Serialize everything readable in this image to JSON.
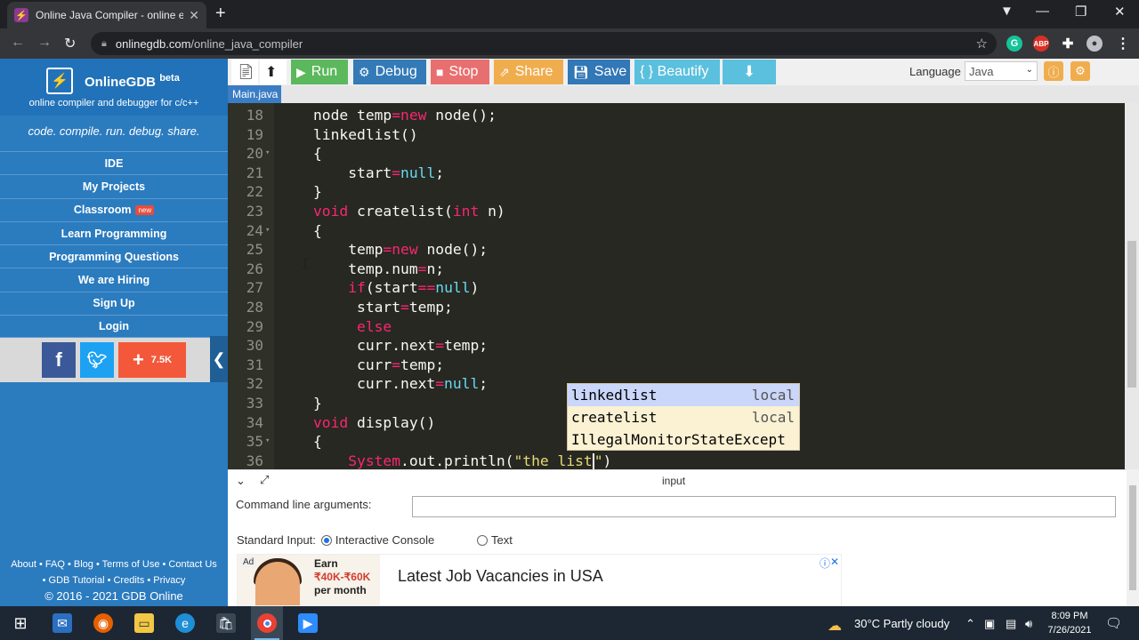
{
  "browser": {
    "tab_title": "Online Java Compiler - online ed",
    "tab_close": "✕",
    "new_tab": "+",
    "url_host": "onlinegdb.com",
    "url_path": "/online_java_compiler"
  },
  "sidebar": {
    "brand": "OnlineGDB",
    "beta": "beta",
    "tagline": "online compiler and debugger for c/c++",
    "motto": "code. compile. run. debug. share.",
    "items": [
      {
        "label": "IDE"
      },
      {
        "label": "My Projects"
      },
      {
        "label": "Classroom",
        "badge": "new"
      },
      {
        "label": "Learn Programming"
      },
      {
        "label": "Programming Questions"
      },
      {
        "label": "We are Hiring"
      },
      {
        "label": "Sign Up"
      },
      {
        "label": "Login"
      }
    ],
    "share_count": "7.5K",
    "footer_line1": "About • FAQ • Blog • Terms of Use • Contact Us",
    "footer_line2": "• GDB Tutorial • Credits • Privacy",
    "copyright": "© 2016 - 2021 GDB Online"
  },
  "toolbar": {
    "run": "Run",
    "debug": "Debug",
    "stop": "Stop",
    "share": "Share",
    "save": "Save",
    "beautify": "{ } Beautify",
    "language_label": "Language",
    "language_value": "Java",
    "colors": {
      "run": "#5cb85c",
      "debug": "#337ab7",
      "stop": "#e86f6f",
      "share": "#f0ad4e",
      "save": "#3277b6",
      "beautify": "#5bc0de",
      "download": "#5bc0de"
    }
  },
  "file_tab": "Main.java",
  "editor": {
    "lines": [
      {
        "n": "18",
        "fold": "",
        "html": "node temp<span class=\"sy\">=</span><span class=\"kw\">new</span> node();"
      },
      {
        "n": "19",
        "fold": "",
        "html": "linkedlist()"
      },
      {
        "n": "20",
        "fold": "▾",
        "html": "{"
      },
      {
        "n": "21",
        "fold": "",
        "html": "    start<span class=\"sy\">=</span><span class=\"nl\">null</span>;"
      },
      {
        "n": "22",
        "fold": "",
        "html": "}"
      },
      {
        "n": "23",
        "fold": "",
        "html": "<span class=\"kw\">void</span> createlist(<span class=\"kw\">int</span> n)"
      },
      {
        "n": "24",
        "fold": "▾",
        "html": "{"
      },
      {
        "n": "25",
        "fold": "",
        "html": "    temp<span class=\"sy\">=</span><span class=\"kw\">new</span> node();"
      },
      {
        "n": "26",
        "fold": "",
        "html": "    temp.num<span class=\"sy\">=</span>n;"
      },
      {
        "n": "27",
        "fold": "",
        "html": "    <span class=\"kw\">if</span>(start<span class=\"sy\">==</span><span class=\"nl\">null</span>)"
      },
      {
        "n": "28",
        "fold": "",
        "html": "     start<span class=\"sy\">=</span>temp;"
      },
      {
        "n": "29",
        "fold": "",
        "html": "     <span class=\"kw\">else</span>"
      },
      {
        "n": "30",
        "fold": "",
        "html": "     curr.next<span class=\"sy\">=</span>temp;"
      },
      {
        "n": "31",
        "fold": "",
        "html": "     curr<span class=\"sy\">=</span>temp;"
      },
      {
        "n": "32",
        "fold": "",
        "html": "     curr.next<span class=\"sy\">=</span><span class=\"nl\">null</span>;"
      },
      {
        "n": "33",
        "fold": "",
        "html": "}"
      },
      {
        "n": "34",
        "fold": "",
        "html": "<span class=\"kw\">void</span> display()"
      },
      {
        "n": "35",
        "fold": "▾",
        "html": "{"
      },
      {
        "n": "36",
        "fold": "",
        "html": "    <span class=\"kw\">System</span>.out.println(<span class=\"st\">\"the list</span><span class=\"caret\"></span><span class=\"st\">\"</span>)"
      }
    ],
    "autocomplete": [
      {
        "word": "linkedlist",
        "meta": "local"
      },
      {
        "word": "createlist",
        "meta": "local"
      },
      {
        "word": "IllegalMonitorStateExcept",
        "meta": ""
      }
    ]
  },
  "io": {
    "title": "input",
    "cmd_label": "Command line arguments:",
    "stdin_label": "Standard Input:",
    "opt_console": "Interactive Console",
    "opt_text": "Text"
  },
  "ad": {
    "label": "Ad",
    "earn": "Earn",
    "amount": "₹40K-₹60K",
    "per": "per month",
    "headline": "Latest Job Vacancies in USA"
  },
  "taskbar": {
    "weather": "30°C  Partly cloudy",
    "time": "8:09 PM",
    "date": "7/26/2021"
  }
}
